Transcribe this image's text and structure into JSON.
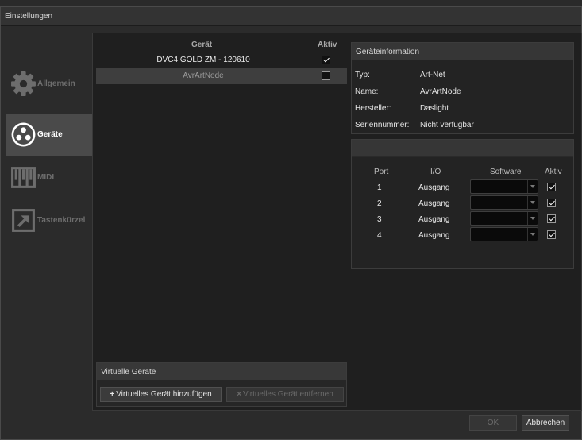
{
  "window": {
    "title": "Einstellungen"
  },
  "sidebar": {
    "items": [
      {
        "label": "Allgemein",
        "icon": "gear-icon",
        "active": false
      },
      {
        "label": "Geräte",
        "icon": "devices-icon",
        "active": true
      },
      {
        "label": "MIDI",
        "icon": "midi-keyboard-icon",
        "active": false
      },
      {
        "label": "Tastenkürzel",
        "icon": "shortcut-arrow-icon",
        "active": false
      }
    ]
  },
  "devices": {
    "header_device": "Gerät",
    "header_active": "Aktiv",
    "rows": [
      {
        "name": "DVC4 GOLD ZM - 120610",
        "active": true,
        "selected": false
      },
      {
        "name": "AvrArtNode",
        "active": false,
        "selected": true
      }
    ]
  },
  "virtual": {
    "title": "Virtuelle Geräte",
    "add_label": "Virtuelles Gerät hinzufügen",
    "remove_label": "Virtuelles Gerät entfernen"
  },
  "info": {
    "title": "Geräteinformation",
    "rows": [
      {
        "key": "Typ:",
        "value": "Art-Net"
      },
      {
        "key": "Name:",
        "value": "AvrArtNode"
      },
      {
        "key": "Hersteller:",
        "value": "Daslight"
      },
      {
        "key": "Seriennummer:",
        "value": "Nicht verfügbar"
      }
    ]
  },
  "ports": {
    "title": "",
    "header_port": "Port",
    "header_io": "I/O",
    "header_software": "Software",
    "header_active": "Aktiv",
    "rows": [
      {
        "port": "1",
        "io": "Ausgang",
        "software": "",
        "active": true
      },
      {
        "port": "2",
        "io": "Ausgang",
        "software": "",
        "active": true
      },
      {
        "port": "3",
        "io": "Ausgang",
        "software": "",
        "active": true
      },
      {
        "port": "4",
        "io": "Ausgang",
        "software": "",
        "active": true
      }
    ]
  },
  "footer": {
    "ok_label": "OK",
    "cancel_label": "Abbrechen"
  },
  "colors": {
    "accent_selected": "#4a4a4a",
    "background": "#2b2b2b",
    "panel": "#1f1f1f"
  }
}
